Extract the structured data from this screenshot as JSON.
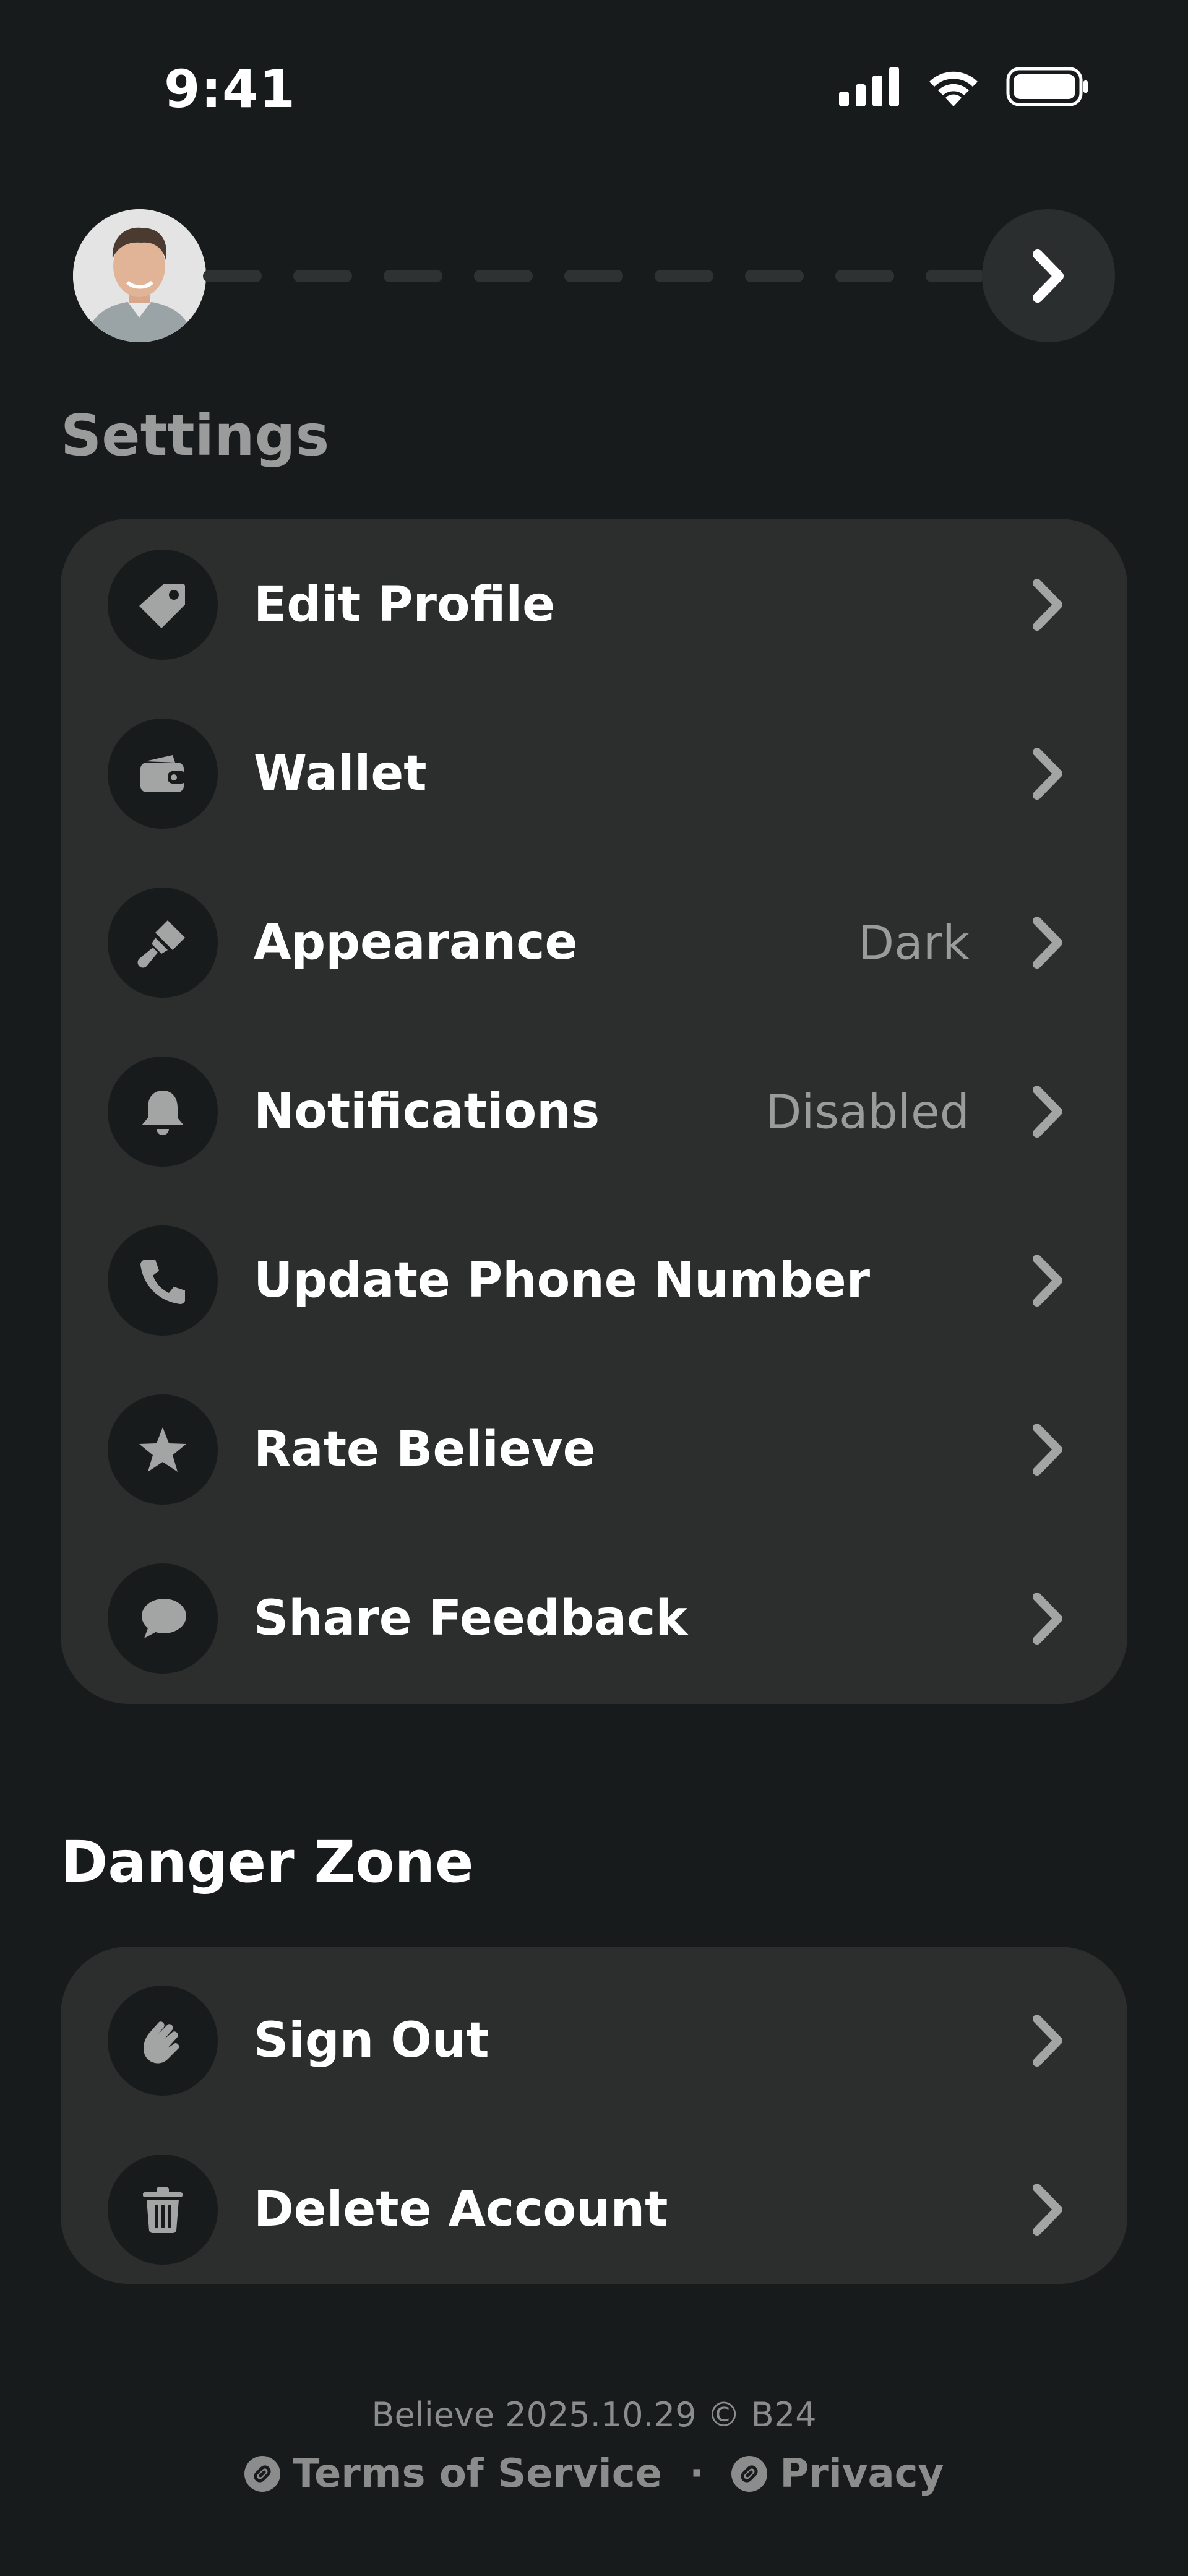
{
  "status_bar": {
    "time": "9:41",
    "icons": [
      "signal-icon",
      "wifi-icon",
      "battery-icon"
    ]
  },
  "header": {
    "avatar_icon": "avatar",
    "next_icon": "chevron-right-icon"
  },
  "settings": {
    "title": "Settings",
    "items": [
      {
        "label": "Edit Profile",
        "value": "",
        "icon": "tag-icon"
      },
      {
        "label": "Wallet",
        "value": "",
        "icon": "wallet-icon"
      },
      {
        "label": "Appearance",
        "value": "Dark",
        "icon": "paint-brush-icon"
      },
      {
        "label": "Notifications",
        "value": "Disabled",
        "icon": "bell-icon"
      },
      {
        "label": "Update Phone Number",
        "value": "",
        "icon": "phone-icon"
      },
      {
        "label": "Rate Believe",
        "value": "",
        "icon": "star-icon"
      },
      {
        "label": "Share Feedback",
        "value": "",
        "icon": "chat-bubble-icon"
      }
    ]
  },
  "danger_zone": {
    "title": "Danger Zone",
    "items": [
      {
        "label": "Sign Out",
        "icon": "waving-hand-icon"
      },
      {
        "label": "Delete Account",
        "icon": "trash-icon"
      }
    ]
  },
  "footer": {
    "version": "Believe 2025.10.29 © B24",
    "terms": "Terms of Service",
    "separator": "·",
    "privacy": "Privacy"
  },
  "colors": {
    "background": "#171b1b",
    "card": "#2c2d2d",
    "muted_text": "#9a9c9c",
    "icon_gray": "#a3a5a5"
  }
}
